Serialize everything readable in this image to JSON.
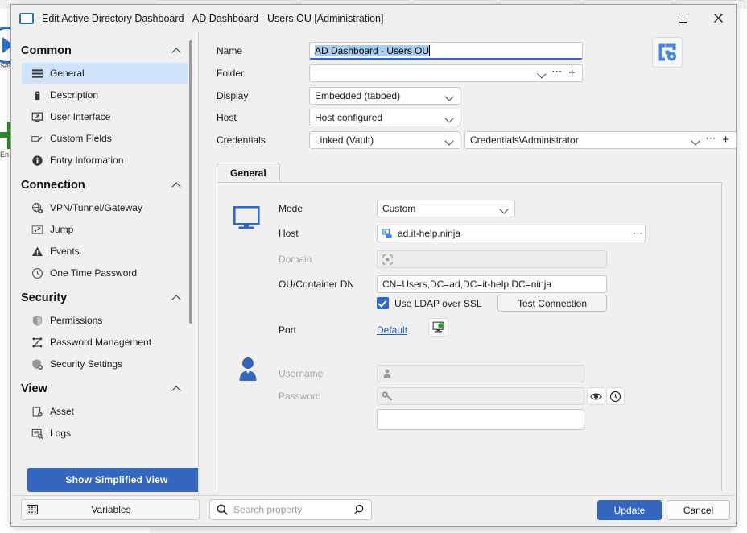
{
  "window": {
    "title": "Edit Active Directory Dashboard - AD Dashboard - Users OU [Administration]",
    "title_icon": "monitor-icon",
    "maximize_icon": "maximize-icon",
    "close_icon": "close-icon",
    "accent_color": "#3566c0"
  },
  "sidebar": {
    "groups": [
      {
        "label": "Common",
        "items": [
          {
            "label": "General",
            "icon": "list-lines-icon",
            "active": true
          },
          {
            "label": "Description",
            "icon": "tag-icon",
            "active": false
          },
          {
            "label": "User Interface",
            "icon": "monitor-cursor-icon",
            "active": false
          },
          {
            "label": "Custom Fields",
            "icon": "field-edit-icon",
            "active": false
          },
          {
            "label": "Entry Information",
            "icon": "info-icon",
            "active": false
          }
        ]
      },
      {
        "label": "Connection",
        "items": [
          {
            "label": "VPN/Tunnel/Gateway",
            "icon": "globe-gear-icon",
            "active": false
          },
          {
            "label": "Jump",
            "icon": "jump-icon",
            "active": false
          },
          {
            "label": "Events",
            "icon": "warning-triangle-icon",
            "active": false
          },
          {
            "label": "One Time Password",
            "icon": "clock-icon",
            "active": false
          }
        ]
      },
      {
        "label": "Security",
        "items": [
          {
            "label": "Permissions",
            "icon": "shield-icon",
            "active": false
          },
          {
            "label": "Password Management",
            "icon": "password-graph-icon",
            "active": false
          },
          {
            "label": "Security Settings",
            "icon": "shield-gear-icon",
            "active": false
          }
        ]
      },
      {
        "label": "View",
        "items": [
          {
            "label": "Asset",
            "icon": "clipboard-gear-icon",
            "active": false
          },
          {
            "label": "Logs",
            "icon": "log-list-icon",
            "active": false
          }
        ]
      }
    ],
    "simplified_view_button": "Show Simplified View"
  },
  "form": {
    "name": {
      "label": "Name",
      "value": "AD Dashboard - Users OU",
      "selected": true
    },
    "folder": {
      "label": "Folder",
      "value": "",
      "dropdown_icon": "chevron-down-icon",
      "more_icon": "ellipsis-icon",
      "add_icon": "plus-icon"
    },
    "display": {
      "label": "Display",
      "value": "Embedded (tabbed)",
      "dropdown_icon": "chevron-down-icon"
    },
    "host": {
      "label": "Host",
      "value": "Host configured",
      "dropdown_icon": "chevron-down-icon"
    },
    "credentials": {
      "label": "Credentials",
      "value": "Linked (Vault)",
      "linked_value": "Credentials\\Administrator",
      "dropdown_icon": "chevron-down-icon",
      "more_icon": "ellipsis-icon",
      "add_icon": "plus-icon"
    },
    "app_icon": "active-directory-gear-icon"
  },
  "panel": {
    "tabs": [
      {
        "label": "General",
        "active": true
      }
    ],
    "connection_icon": "monitor-icon",
    "user_icon": "user-icon",
    "mode": {
      "label": "Mode",
      "value": "Custom",
      "dropdown_icon": "chevron-down-icon"
    },
    "host": {
      "label": "Host",
      "value": "ad.it-help.ninja",
      "icon": "server-icon",
      "more_icon": "ellipsis-icon"
    },
    "domain": {
      "label": "Domain",
      "value": "",
      "icon": "domain-icon",
      "disabled": true
    },
    "ou_dn": {
      "label": "OU/Container DN",
      "value": "CN=Users,DC=ad,DC=it-help,DC=ninja"
    },
    "ldap_ssl": {
      "label": "Use LDAP over SSL",
      "checked": true
    },
    "test_connection_button": "Test Connection",
    "port": {
      "label": "Port",
      "link_label": "Default",
      "icon": "monitor-port-icon"
    },
    "username": {
      "label": "Username",
      "value": "",
      "icon": "user-small-icon",
      "disabled": true
    },
    "password": {
      "label": "Password",
      "value": "",
      "icon": "key-icon",
      "disabled": true,
      "reveal_icon": "eye-icon",
      "history_icon": "password-history-icon"
    },
    "extra_field": {
      "value": ""
    }
  },
  "footer": {
    "variables_button": "Variables",
    "variables_icon": "grid-dots-icon",
    "search": {
      "placeholder": "Search property",
      "value": "",
      "icon": "search-icon",
      "action_icon": "magnifier-icon"
    },
    "update_button": "Update",
    "cancel_button": "Cancel"
  }
}
